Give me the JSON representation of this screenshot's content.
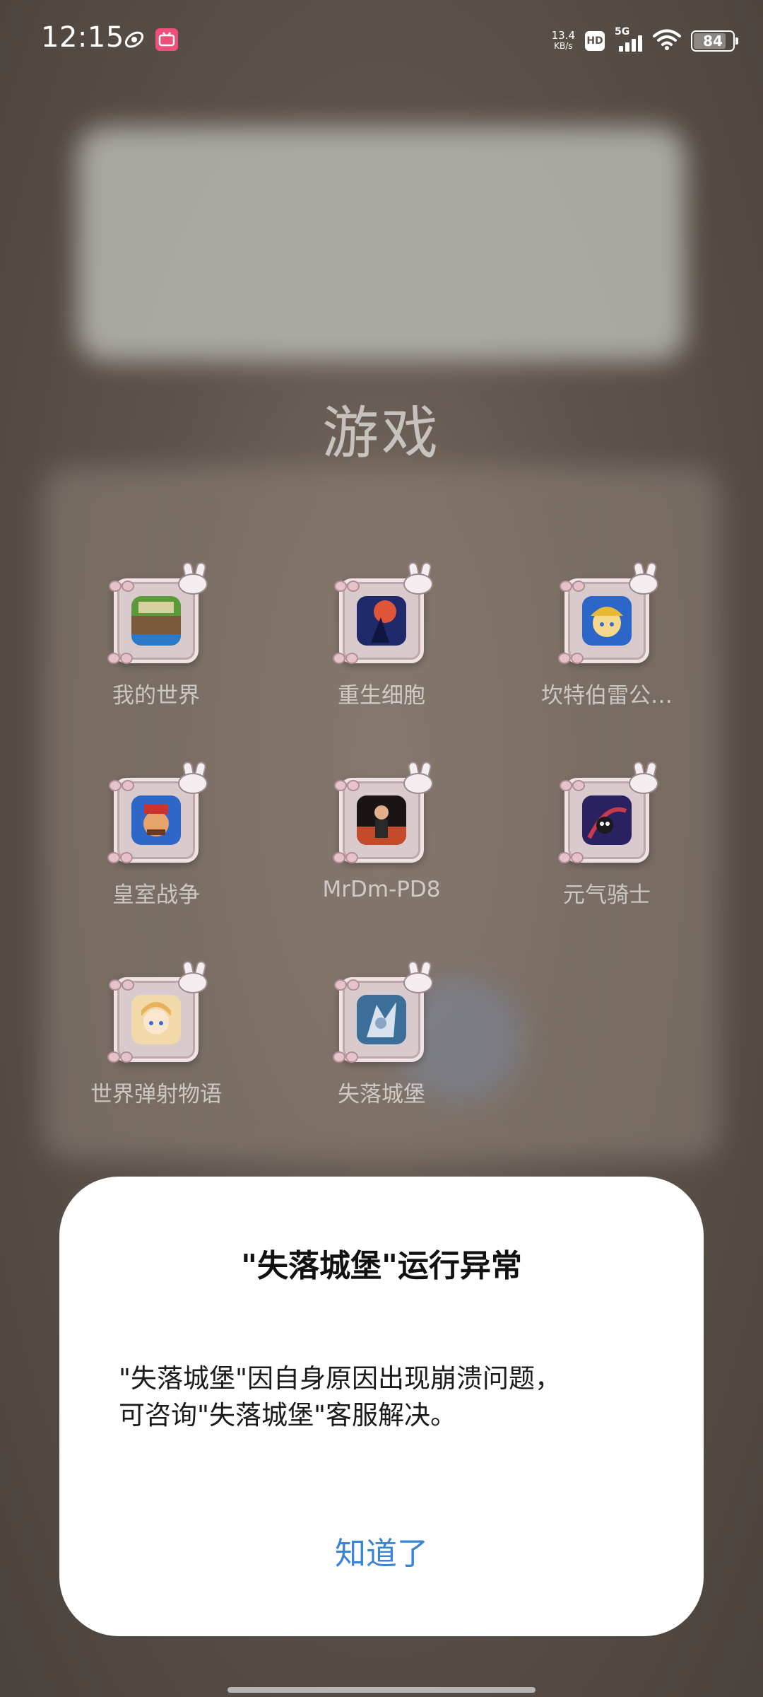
{
  "status_bar": {
    "time": "12:15",
    "net_speed_value": "13.4",
    "net_speed_unit": "KB/s",
    "hd_label": "HD",
    "network_label": "5G",
    "battery_percent": "84",
    "battery_level": 0.84
  },
  "folder": {
    "title": "游戏",
    "apps": [
      {
        "label": "我的世界",
        "icon": "minecraft-icon",
        "color": "#3f7a2f"
      },
      {
        "label": "重生细胞",
        "icon": "dead-cells-icon",
        "color": "#2b3a8a"
      },
      {
        "label": "坎特伯雷公…",
        "icon": "guardian-tales-icon",
        "color": "#2c66c9"
      },
      {
        "label": "皇室战争",
        "icon": "clash-royale-icon",
        "color": "#2f67c9"
      },
      {
        "label": "MrDm-PD8",
        "icon": "mrdm-icon",
        "color": "#6b2a22"
      },
      {
        "label": "元气骑士",
        "icon": "soul-knight-icon",
        "color": "#3a2d7a"
      },
      {
        "label": "世界弹射物语",
        "icon": "world-flipper-icon",
        "color": "#e9c38c"
      },
      {
        "label": "失落城堡",
        "icon": "lost-castle-icon",
        "color": "#3c6e9a"
      }
    ]
  },
  "dialog": {
    "title": "\"失落城堡\"运行异常",
    "message_line1": "\"失落城堡\"因自身原因出现崩溃问题，",
    "message_line2": "可咨询\"失落城堡\"客服解决。",
    "ok_label": "知道了",
    "accent_color": "#3a84d7"
  }
}
